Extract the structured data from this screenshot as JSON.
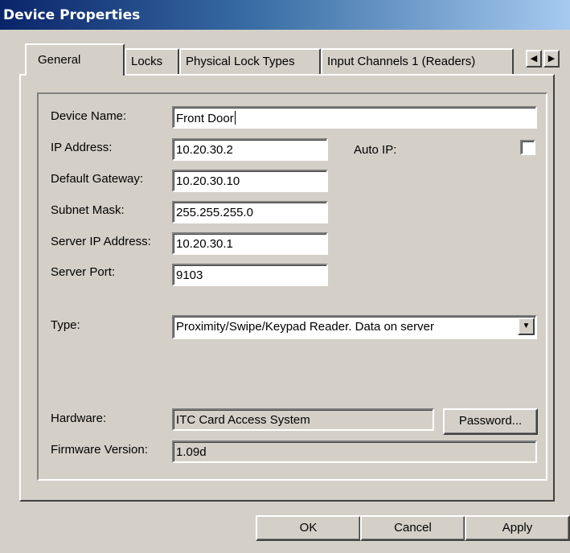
{
  "window": {
    "title": "Device Properties"
  },
  "tabs": [
    {
      "label": "General",
      "active": true
    },
    {
      "label": "Locks"
    },
    {
      "label": "Physical Lock Types"
    },
    {
      "label": "Input Channels 1 (Readers)"
    }
  ],
  "tab_scroll": {
    "left_icon": "arrow-left-icon",
    "right_icon": "arrow-right-icon",
    "left_glyph": "◀",
    "right_glyph": "▶"
  },
  "form": {
    "device_name": {
      "label": "Device Name:",
      "value": "Front Door"
    },
    "ip_address": {
      "label": "IP Address:",
      "value": "10.20.30.2"
    },
    "auto_ip": {
      "label": "Auto IP:",
      "checked": false
    },
    "default_gateway": {
      "label": "Default Gateway:",
      "value": "10.20.30.10"
    },
    "subnet_mask": {
      "label": "Subnet Mask:",
      "value": "255.255.255.0"
    },
    "server_ip": {
      "label": "Server IP Address:",
      "value": "10.20.30.1"
    },
    "server_port": {
      "label": "Server Port:",
      "value": "9103"
    },
    "type": {
      "label": "Type:",
      "value": "Proximity/Swipe/Keypad Reader. Data on server",
      "dropdown_glyph": "▼"
    },
    "hardware": {
      "label": "Hardware:",
      "value": "ITC Card Access System"
    },
    "password_button": "Password...",
    "firmware": {
      "label": "Firmware Version:",
      "value": "1.09d"
    }
  },
  "buttons": {
    "ok": "OK",
    "cancel": "Cancel",
    "apply": "Apply"
  },
  "colors": {
    "face": "#d4d0c8",
    "title_start": "#0a246a",
    "title_end": "#a6caf0"
  }
}
